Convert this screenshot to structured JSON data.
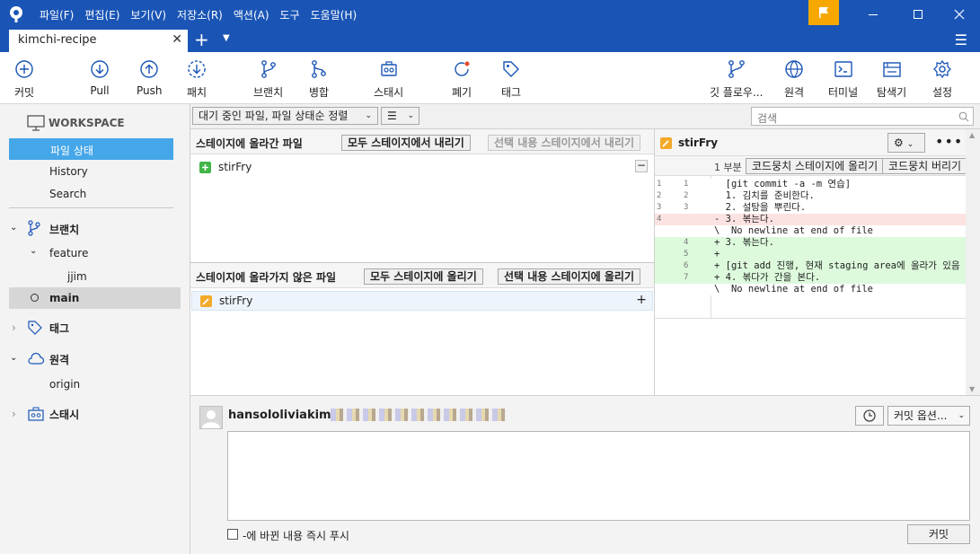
{
  "menu": [
    "파일(F)",
    "편집(E)",
    "보기(V)",
    "저장소(R)",
    "액션(A)",
    "도구",
    "도움말(H)"
  ],
  "tab": {
    "title": "kimchi-recipe"
  },
  "toolbar": {
    "commit": "커밋",
    "pull": "Pull",
    "push": "Push",
    "fetch": "패치",
    "branch": "브랜치",
    "merge": "병합",
    "stash": "스태시",
    "discard": "폐기",
    "tag": "태그",
    "gitflow": "깃 플로우...",
    "remote": "원격",
    "terminal": "터미널",
    "explorer": "탐색기",
    "settings": "설정"
  },
  "sidebar": {
    "workspace": "WORKSPACE",
    "file_status": "파일 상태",
    "history": "History",
    "search": "Search",
    "branches": "브랜치",
    "feature": "feature",
    "jjim": "jjim",
    "main": "main",
    "tags": "태그",
    "remotes": "원격",
    "origin": "origin",
    "stashes": "스태시"
  },
  "filter": {
    "sort_label": "대기 중인 파일, 파일 상태순 정렬",
    "search_placeholder": "검색"
  },
  "staged": {
    "title": "스테이지에 올라간 파일",
    "unstage_all": "모두 스테이지에서 내리기",
    "unstage_sel": "선택 내용 스테이지에서 내리기",
    "files": [
      {
        "name": "stirFry"
      }
    ]
  },
  "unstaged": {
    "title": "스테이지에 올라가지 않은 파일",
    "stage_all": "모두 스테이지에 올리기",
    "stage_sel": "선택 내용 스테이지에 올리기",
    "files": [
      {
        "name": "stirFry"
      }
    ]
  },
  "diff": {
    "file": "stirFry",
    "hunk_label": "1 부분",
    "stage_hunk": "코드뭉치 스테이지에 올리기",
    "discard_hunk": "코드뭉치 버리기",
    "lines": [
      {
        "old": "1",
        "new": "1",
        "type": "ctx",
        "text": "  [git commit -a -m 연습]"
      },
      {
        "old": "2",
        "new": "2",
        "type": "ctx",
        "text": "  1. 김치를 준비한다."
      },
      {
        "old": "3",
        "new": "3",
        "type": "ctx",
        "text": "  2. 설탕을 뿌린다."
      },
      {
        "old": "4",
        "new": "",
        "type": "del",
        "text": "- 3. 볶는다."
      },
      {
        "old": "",
        "new": "",
        "type": "ctx",
        "text": "\\  No newline at end of file"
      },
      {
        "old": "",
        "new": "4",
        "type": "add",
        "text": "+ 3. 볶는다."
      },
      {
        "old": "",
        "new": "5",
        "type": "add",
        "text": "+"
      },
      {
        "old": "",
        "new": "6",
        "type": "add",
        "text": "+ [git add 진행, 현재 staging area에 올라가 있음"
      },
      {
        "old": "",
        "new": "7",
        "type": "add",
        "text": "+ 4. 볶다가 간을 본다."
      },
      {
        "old": "",
        "new": "",
        "type": "ctx",
        "text": "\\  No newline at end of file"
      }
    ]
  },
  "commit": {
    "author": "hansololiviakim",
    "options": "커밋 옵션...",
    "push_label": "-에 바뀐 내용 즉시 푸시",
    "commit_button": "커밋"
  },
  "colors": {
    "accent": "#1a55b6",
    "selection": "#45a6e8",
    "added": "#ddfadc",
    "removed": "#fde2e2",
    "modified_badge": "#f3a92a",
    "added_badge": "#41b548"
  }
}
